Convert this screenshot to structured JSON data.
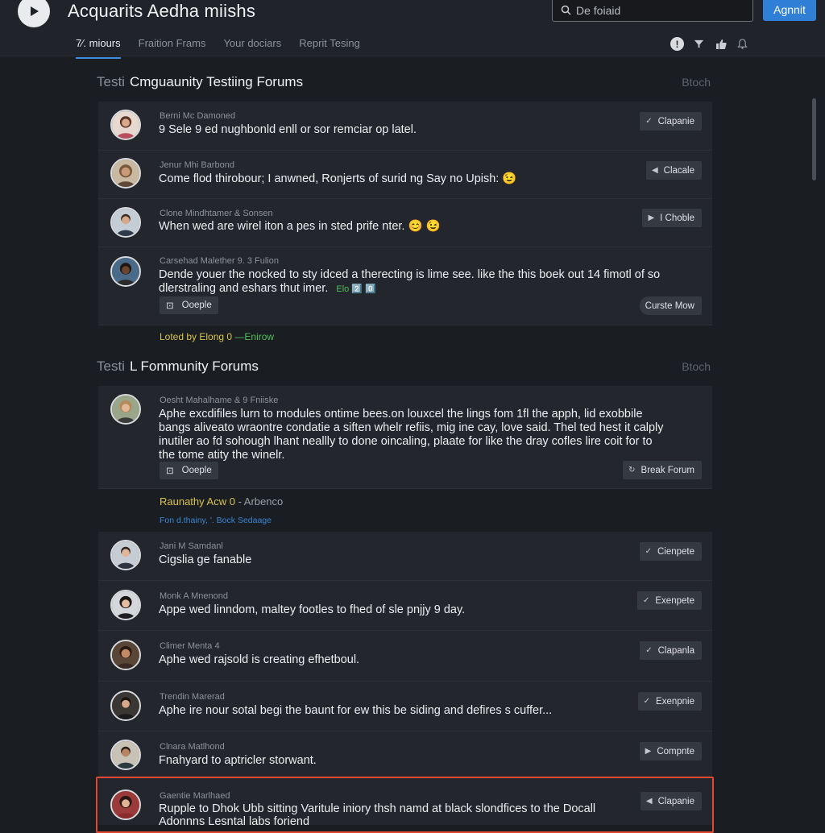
{
  "app": {
    "title": "Acquarits Aedha miishs"
  },
  "search": {
    "placeholder": "De foiaid"
  },
  "header": {
    "primary_button": "Agnnit"
  },
  "tabs": [
    {
      "label": "7⁄. miours",
      "active": true
    },
    {
      "label": "Fraition Frams",
      "active": false
    },
    {
      "label": "Your dociars",
      "active": false
    },
    {
      "label": "Reprit Tesing",
      "active": false
    }
  ],
  "top_icons": [
    "info-icon",
    "filter-icon",
    "thumbs-up-icon",
    "bell-icon"
  ],
  "section1": {
    "prefix": "Testi",
    "title": "Cmguaunity Testiing Forums",
    "right": "Btoch",
    "posts": [
      {
        "author": "Berni Mc Damoned",
        "text": "9 Sele 9 ed nughbonld enll or sor remciar op latel.",
        "action": "Clapanie",
        "action_icon": "check"
      },
      {
        "author": "Jenur Mhi Barbond",
        "text": "Come flod thirobour; I anwned, Ronjerts of surid ng Say no Upish: 😉",
        "action": "Clacale",
        "action_icon": "back"
      },
      {
        "author": "Clone Mindhtamer & Sonsen",
        "text": "When wed are wirel iton a pes in sted prife nter. 😊 😉",
        "action": "I Choble",
        "action_icon": "play"
      },
      {
        "author": "Carsehad Malether 9. 3 Fulion",
        "text": "Dende youer the nocked to sty idced a therecting is lime see. like the this boek out 14 fimotl of so",
        "text2": "dlerstraling and eshars thut imer.",
        "text2_tag": "Elo 2️⃣ 0️⃣",
        "chip": "Ooeple",
        "action": "Curste Mow",
        "action_icon": ""
      }
    ]
  },
  "note1": {
    "text": "Loted by Elong 0",
    "green": "—Enirow"
  },
  "section2": {
    "prefix": "Testi",
    "title": "L Fommunity Forums",
    "right": "Btoch",
    "post": {
      "author": "Oesht Mahalhame & 9 Fniiske",
      "lines": [
        "Aphe excdifiles lurn to rnodules ontime bees.on louxcel the lings fom 1fl the apph, lid exobbile",
        "bangs aliveato wraontre condatie a siften whelr refiis, mig ine cay, love said. Thel ted hest it calply",
        "inutiler ao fd sohough lhant neallly to done oincaling, plaate for like the dray cofles lire coit for to",
        "the tome atity the winelr."
      ],
      "chip": "Ooeple",
      "action": "Break Forum"
    }
  },
  "note2": {
    "text": "Raunathy Acw 0",
    "rest": "- Arbenco"
  },
  "note3": {
    "text": "Fon d.thainy, '. Bock Sedaage"
  },
  "list": [
    {
      "author": "Jani M Samdanl",
      "text": "Cigslia ge fanable",
      "action": "Cienpete",
      "icon": "check"
    },
    {
      "author": "Monk A Mnenond",
      "text": "Appe wed linndom, maltey footles to fhed of sle pnjjy 9 day.",
      "action": "Exenpete",
      "icon": "check"
    },
    {
      "author": "Climer Menta 4",
      "text": "Aphe wed rajsold is creating efhetboul.",
      "action": "Clapanla",
      "icon": "check"
    },
    {
      "author": "Trendin Marerad",
      "text": "Aphe ire nour sotal begi the baunt for ew this be siding and defires s cuffer...",
      "action": "Exenpnie",
      "icon": "check"
    },
    {
      "author": "Clnara Matlhond",
      "text": "Fnahyard to aptricler storwant.",
      "action": "Compnte",
      "icon": "play"
    },
    {
      "author": "Gaentie Marlhaed",
      "text": "Rupple to Dhok Ubb sitting Varitule iniory thsh namd at black slondfices to the Docall",
      "text2": "Adonnns Lesntal labs foriend",
      "action": "Clapanie",
      "icon": "back",
      "highlighted": true
    }
  ],
  "colors": {
    "background": "#1a1d22",
    "card": "#23262c",
    "accent": "#2f7fd6",
    "highlight": "#e2472f"
  }
}
